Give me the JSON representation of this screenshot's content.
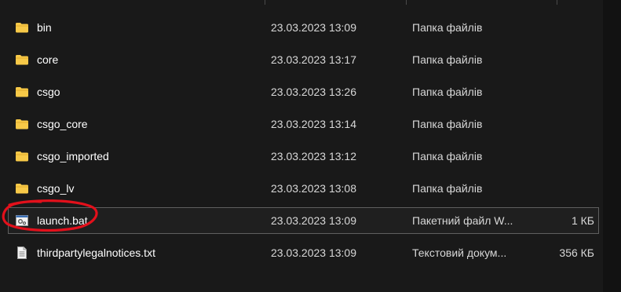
{
  "files": [
    {
      "name": "bin",
      "date": "23.03.2023 13:09",
      "type": "Папка файлів",
      "size": "",
      "icon": "folder-icon"
    },
    {
      "name": "core",
      "date": "23.03.2023 13:17",
      "type": "Папка файлів",
      "size": "",
      "icon": "folder-icon"
    },
    {
      "name": "csgo",
      "date": "23.03.2023 13:26",
      "type": "Папка файлів",
      "size": "",
      "icon": "folder-icon"
    },
    {
      "name": "csgo_core",
      "date": "23.03.2023 13:14",
      "type": "Папка файлів",
      "size": "",
      "icon": "folder-icon"
    },
    {
      "name": "csgo_imported",
      "date": "23.03.2023 13:12",
      "type": "Папка файлів",
      "size": "",
      "icon": "folder-icon"
    },
    {
      "name": "csgo_lv",
      "date": "23.03.2023 13:08",
      "type": "Папка файлів",
      "size": "",
      "icon": "folder-icon"
    },
    {
      "name": "launch.bat",
      "date": "23.03.2023 13:09",
      "type": "Пакетний файл W...",
      "size": "1 КБ",
      "icon": "batch-file-icon"
    },
    {
      "name": "thirdpartylegalnotices.txt",
      "date": "23.03.2023 13:09",
      "type": "Текстовий докум...",
      "size": "356 КБ",
      "icon": "text-file-icon"
    }
  ],
  "colors": {
    "background": "#191919",
    "folder": "#f7c948",
    "annotation": "#e3101b",
    "selection_border": "#5f5f5f"
  }
}
